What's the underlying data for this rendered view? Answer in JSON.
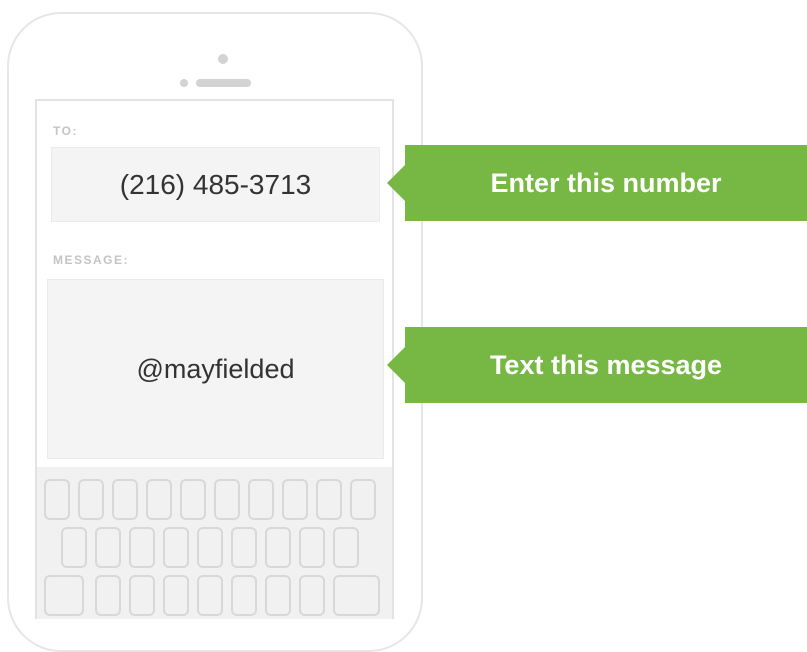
{
  "screen": {
    "to_label": "TO:",
    "number": "(216) 485-3713",
    "message_label": "MESSAGE:",
    "message": "@mayfielded"
  },
  "callouts": {
    "enter_number": "Enter this number",
    "text_message": "Text this message"
  },
  "colors": {
    "callout_green": "#76b843",
    "field_bg": "#f4f4f4",
    "label_gray": "#c4c4c4"
  }
}
